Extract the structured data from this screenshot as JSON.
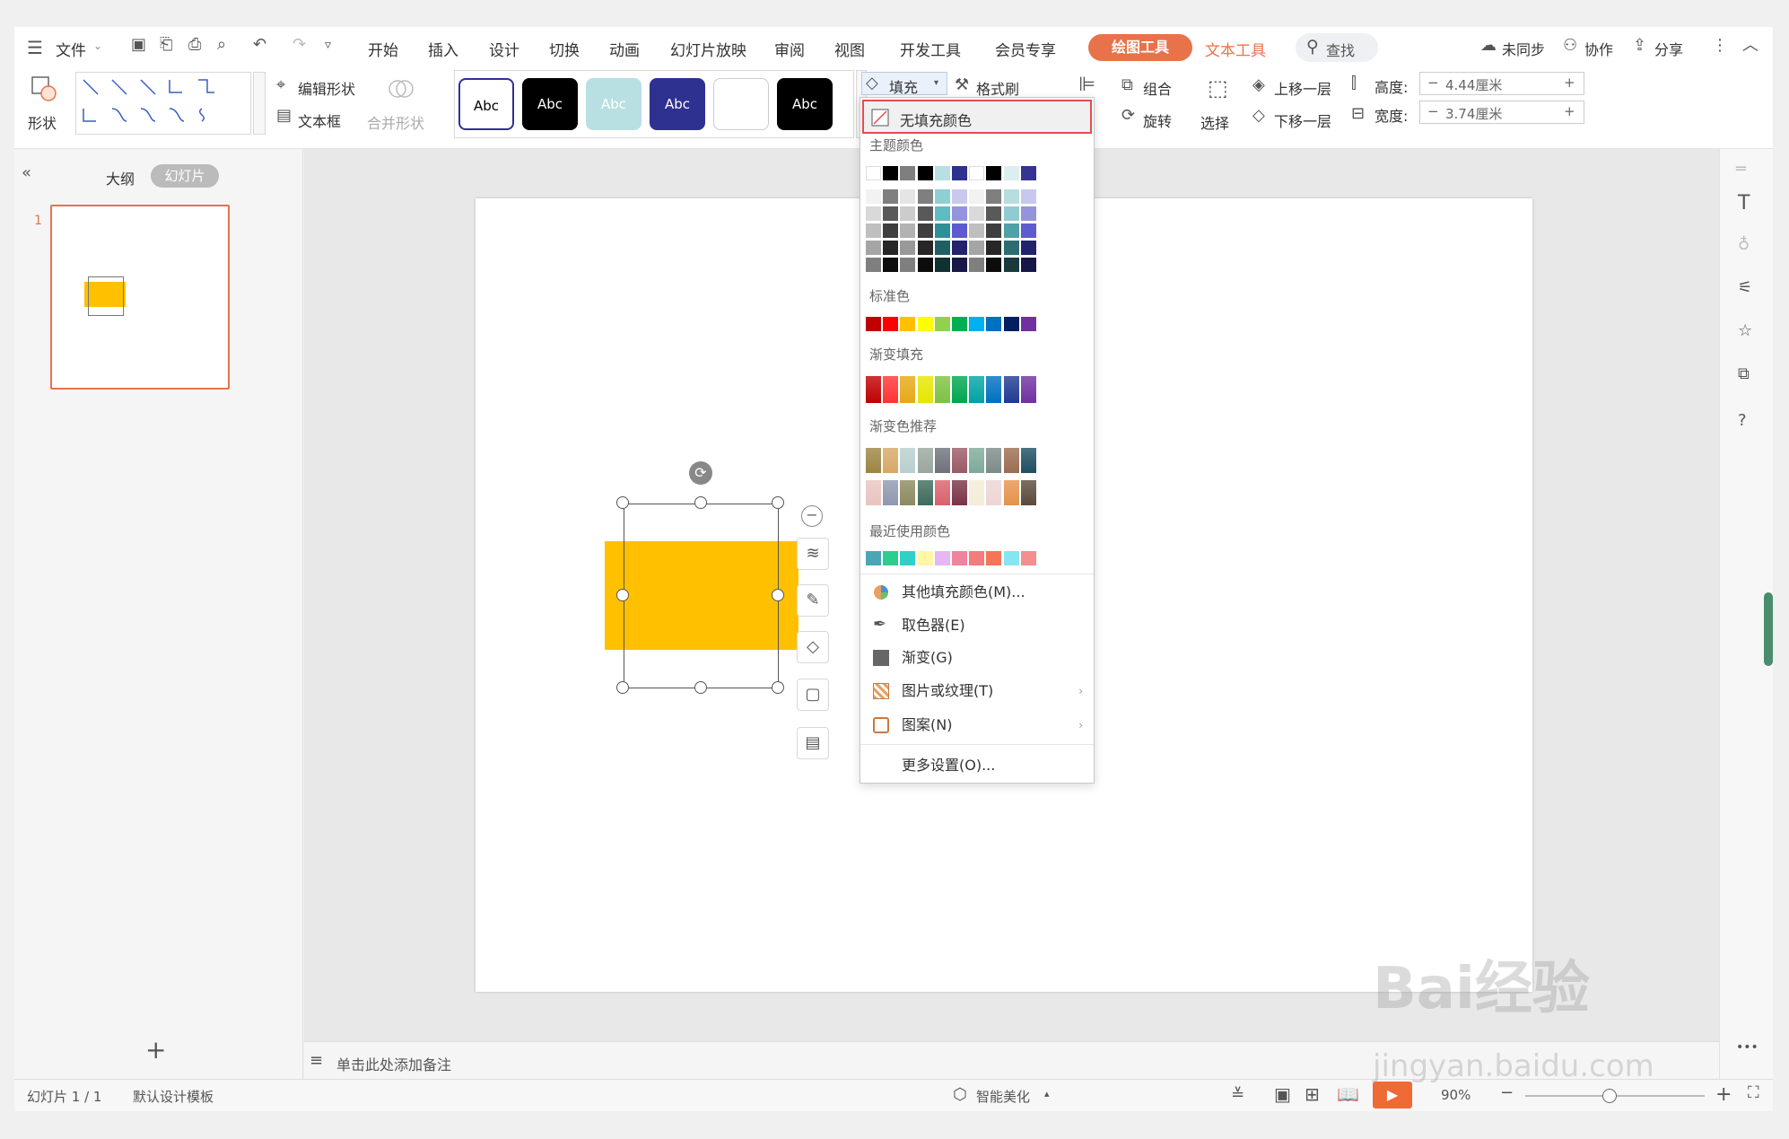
{
  "menubar": {
    "file_label": "文件",
    "tabs": [
      "开始",
      "插入",
      "设计",
      "切换",
      "动画",
      "幻灯片放映",
      "审阅",
      "视图",
      "开发工具",
      "会员专享"
    ],
    "active_tab": "绘图工具",
    "text_tool_tab": "文本工具",
    "search_label": "查找",
    "sync_label": "未同步",
    "collab_label": "协作",
    "share_label": "分享"
  },
  "ribbon": {
    "shape_label": "形状",
    "edit_shape_label": "编辑形状",
    "textbox_label": "文本框",
    "merge_shape_label": "合并形状",
    "style_sample": "Abc",
    "fill_label": "填充",
    "format_painter_label": "格式刷",
    "group_label": "组合",
    "rotate_label": "旋转",
    "select_label": "选择",
    "bring_forward_label": "上移一层",
    "send_backward_label": "下移一层",
    "height_label": "高度:",
    "height_value": "4.44厘米",
    "width_label": "宽度:",
    "width_value": "3.74厘米"
  },
  "left_panel": {
    "outline_tab": "大纲",
    "slides_tab": "幻灯片",
    "slide_number": "1"
  },
  "notes": {
    "placeholder": "单击此处添加备注"
  },
  "status": {
    "slide_info": "幻灯片 1 / 1",
    "template": "默认设计模板",
    "beautify": "智能美化",
    "zoom": "90%"
  },
  "fill_menu": {
    "no_fill": "无填充颜色",
    "theme_colors_label": "主题颜色",
    "theme_top": [
      "#ffffff",
      "#000000",
      "#7f7f7f",
      "#000000",
      "#b8e0e3",
      "#2f3191",
      "#ffffff",
      "#000000",
      "#dbeef0",
      "#35358f"
    ],
    "theme_shades": [
      [
        "#f2f2f2",
        "#7f7f7f",
        "#e5e5e5",
        "#7f7f7f",
        "#8ecfd4",
        "#c9c9ef",
        "#f2f2f2",
        "#7f7f7f",
        "#b6dde0",
        "#c8c8ee"
      ],
      [
        "#d9d9d9",
        "#595959",
        "#cccccc",
        "#595959",
        "#5ebcc3",
        "#9393df",
        "#d9d9d9",
        "#595959",
        "#8fcbd0",
        "#9393de"
      ],
      [
        "#bfbfbf",
        "#3f3f3f",
        "#b2b2b2",
        "#3f3f3f",
        "#2f8f96",
        "#5c5ccf",
        "#bfbfbf",
        "#3f3f3f",
        "#4fa1a8",
        "#5c5ccd"
      ],
      [
        "#a5a5a5",
        "#262626",
        "#999999",
        "#262626",
        "#1f5f64",
        "#23236c",
        "#a5a5a5",
        "#262626",
        "#2d6d72",
        "#23236b"
      ],
      [
        "#7f7f7f",
        "#0c0c0c",
        "#7f7f7f",
        "#0c0c0c",
        "#103032",
        "#171748",
        "#7f7f7f",
        "#0c0c0c",
        "#183a3d",
        "#171747"
      ]
    ],
    "standard_label": "标准色",
    "standard": [
      "#c00000",
      "#ff0000",
      "#ffc000",
      "#ffff00",
      "#92d050",
      "#00b050",
      "#00b0f0",
      "#0070c0",
      "#002060",
      "#7030a0"
    ],
    "gradient_label": "渐变填充",
    "gradient": [
      "#c00000",
      "#ff3333",
      "#e6a817",
      "#e6e600",
      "#7cc242",
      "#00a650",
      "#00a3a3",
      "#0070c0",
      "#1f3a93",
      "#7030a0"
    ],
    "gradient_rec_label": "渐变色推荐",
    "gradient_rec": [
      [
        "#9c8442",
        "#d6a867",
        "#b9cfcd",
        "#9aa69f",
        "#6f727b",
        "#9a5a66",
        "#7eaa9a",
        "#7d8b88",
        "#9c6c52",
        "#1f4e63"
      ],
      [
        "#e9c4c0",
        "#8f98b0",
        "#8c8a60",
        "#3e6b5b",
        "#d9616c",
        "#7a3346",
        "#f5ebd8",
        "#edd5d5",
        "#e6924c",
        "#5b4a3c"
      ]
    ],
    "recent_label": "最近使用颜色",
    "recent": [
      "#4aa6b5",
      "#2ecc8e",
      "#2fd1c7",
      "#fff7a3",
      "#e8b6f2",
      "#f0849c",
      "#f47c7c",
      "#f57558",
      "#85e6f0",
      "#f58f8f"
    ],
    "other_fill": "其他填充颜色(M)...",
    "eyedropper": "取色器(E)",
    "gradient_item": "渐变(G)",
    "picture_texture": "图片或纹理(T)",
    "pattern": "图案(N)",
    "more_settings": "更多设置(O)..."
  },
  "shape_fill_color": "#ffc000",
  "accent_color": "#e8724a",
  "watermark": {
    "brand": "Bai经验",
    "url": "jingyan.baidu.com"
  }
}
